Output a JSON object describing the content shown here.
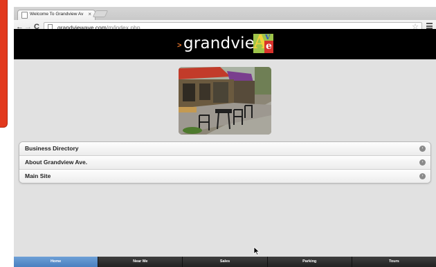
{
  "browser": {
    "tab_title": "Welcome To Grandview Av",
    "tab_close": "×",
    "url_domain": "grandviewave.com",
    "url_path": "/m/index.php",
    "back_glyph": "←",
    "forward_glyph": "→",
    "reload_glyph": "C",
    "bookmark_glyph": "☆"
  },
  "header": {
    "logo_arrow": ">",
    "logo_text": "grandview",
    "logo_letters": [
      "A",
      "v",
      "e"
    ]
  },
  "list": {
    "items": [
      {
        "label": "Business Directory"
      },
      {
        "label": "About Grandview Ave."
      },
      {
        "label": "Main Site"
      }
    ],
    "arrow_glyph": "›"
  },
  "nav": {
    "items": [
      {
        "label": "Home",
        "active": true
      },
      {
        "label": "Near Me",
        "active": false
      },
      {
        "label": "Sales",
        "active": false
      },
      {
        "label": "Parking",
        "active": false
      },
      {
        "label": "Tours",
        "active": false
      }
    ]
  },
  "icons": {
    "back": "back-arrow-icon",
    "forward": "forward-arrow-icon",
    "reload": "reload-icon",
    "page": "page-icon",
    "star": "bookmark-star-icon",
    "menu": "hamburger-menu-icon",
    "chevron": "chevron-right-icon"
  },
  "colors": {
    "header_bg": "#000000",
    "page_bg": "#e1e1e1",
    "nav_active": "#4a80c0",
    "nav_bg": "#2a2a2a",
    "logo_green": "#9ec44a",
    "logo_red": "#d8322b"
  }
}
